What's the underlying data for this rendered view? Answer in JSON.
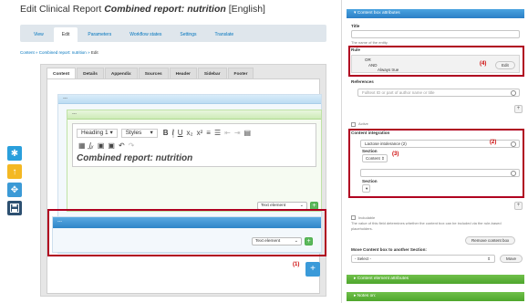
{
  "page": {
    "title_prefix": "Edit Clinical Report ",
    "title_em": "Combined report: nutrition",
    "title_suffix": " [English]"
  },
  "top_tabs": [
    "View",
    "Edit",
    "Parameters",
    "Workflow states",
    "Settings",
    "Translate"
  ],
  "breadcrumb": {
    "link1": "Content",
    "sep": " » ",
    "link2": "Combined report: nutrition",
    "current": "Edit"
  },
  "inner_tabs": [
    "Content",
    "Details",
    "Appendix",
    "Sources",
    "Header",
    "Sidebar",
    "Footer"
  ],
  "boxes": {
    "outer_title": "---",
    "green_title": "---",
    "new_title": "---"
  },
  "editor": {
    "format": "Heading 1",
    "styles": "Styles",
    "content": "Combined report: nutrition"
  },
  "element_select": {
    "value": "Text element"
  },
  "annotations": {
    "a1": "(1)",
    "a2": "(2)",
    "a3": "(3)",
    "a4": "(4)"
  },
  "right": {
    "content_box_header": "Content box attributes",
    "title_label": "Title",
    "title_desc": "The name of the entity.",
    "rule_label": "Rule",
    "rule_or": "OR",
    "rule_and": "AND",
    "rule_true": "Always true",
    "edit_btn": "Edit",
    "references_label": "References",
    "references_placeholder": "Fulltext ID or part of author name or title",
    "active_label": "Active",
    "integration_label": "Content integration",
    "integration_value": "Lactose intolerance (2)",
    "section_label": "Section",
    "section_value": "Content",
    "section_label2": "Section",
    "includable_label": "Includable",
    "includable_desc": "The value of this field determines whether the content box can be included via the rule-based placeholders.",
    "remove_btn": "Remove content box",
    "move_label": "Move Content box to another Section:",
    "move_select": "- Select -",
    "move_btn": "Move",
    "element_attr_header": "Content element attributes",
    "notes_header": "Notes on:"
  },
  "colors": {
    "accent_blue": "#2b7fc6",
    "accent_green": "#4ea62c",
    "highlight_red": "#b00020",
    "link_blue": "#0074bd"
  }
}
